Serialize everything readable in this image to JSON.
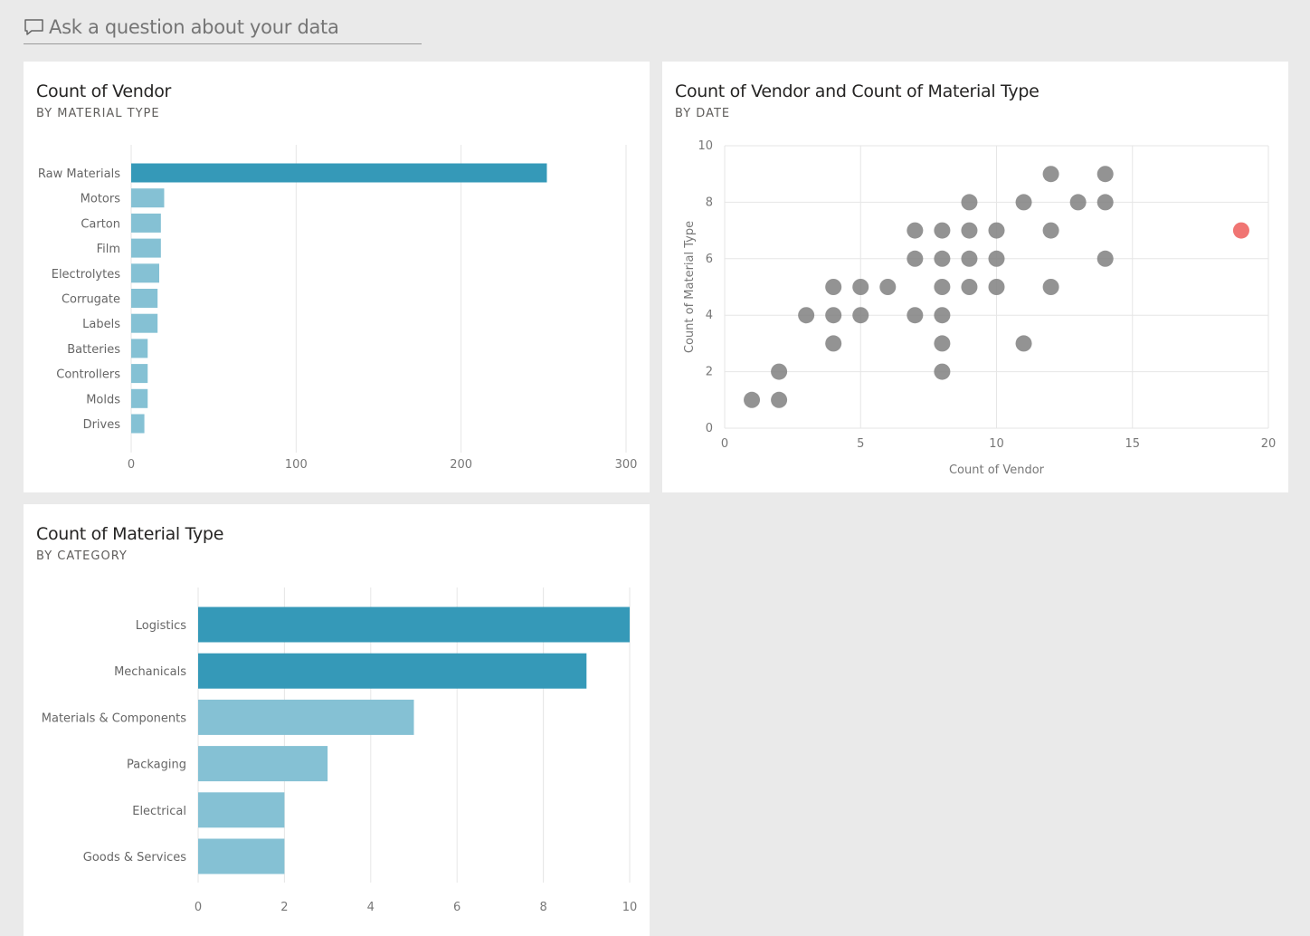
{
  "qa": {
    "placeholder": "Ask a question about your data",
    "icon": "chat-bubble-icon"
  },
  "colors": {
    "bar_dark": "#3599b8",
    "bar_light": "#85c1d4",
    "dot": "#808080",
    "dot_highlight": "#f07573",
    "grid": "#e6e6e6"
  },
  "tiles": [
    {
      "title": "Count of Vendor",
      "subtitle": "BY MATERIAL TYPE",
      "chart_data": {
        "type": "bar",
        "orientation": "horizontal",
        "title": "Count of Vendor",
        "subtitle": "BY MATERIAL TYPE",
        "categories": [
          "Raw Materials",
          "Motors",
          "Carton",
          "Film",
          "Electrolytes",
          "Corrugate",
          "Labels",
          "Batteries",
          "Controllers",
          "Molds",
          "Drives"
        ],
        "values": [
          252,
          20,
          18,
          18,
          17,
          16,
          16,
          10,
          10,
          10,
          8
        ],
        "highlight": [
          true,
          false,
          false,
          false,
          false,
          false,
          false,
          false,
          false,
          false,
          false
        ],
        "xlim": [
          0,
          300
        ],
        "xticks": [
          0,
          100,
          200,
          300
        ],
        "xtick_labels": [
          "0",
          "100",
          "200",
          "300"
        ],
        "grid": true
      }
    },
    {
      "title": "Count of Vendor and Count of Material Type",
      "subtitle": "BY DATE",
      "chart_data": {
        "type": "scatter",
        "title": "Count of Vendor and Count of Material Type",
        "subtitle": "BY DATE",
        "xlabel": "Count of Vendor",
        "ylabel": "Count of Material Type",
        "xlim": [
          0,
          20
        ],
        "ylim": [
          0,
          10
        ],
        "xticks": [
          0,
          5,
          10,
          15,
          20
        ],
        "xtick_labels": [
          "0",
          "5",
          "10",
          "15",
          "20"
        ],
        "yticks": [
          0,
          2,
          4,
          6,
          8,
          10
        ],
        "ytick_labels": [
          "0",
          "2",
          "4",
          "6",
          "8",
          "10"
        ],
        "grid": true,
        "points": [
          {
            "x": 1,
            "y": 1
          },
          {
            "x": 2,
            "y": 1
          },
          {
            "x": 2,
            "y": 2
          },
          {
            "x": 3,
            "y": 4
          },
          {
            "x": 4,
            "y": 4
          },
          {
            "x": 4,
            "y": 3
          },
          {
            "x": 4,
            "y": 5
          },
          {
            "x": 5,
            "y": 4
          },
          {
            "x": 5,
            "y": 5
          },
          {
            "x": 6,
            "y": 5
          },
          {
            "x": 7,
            "y": 4
          },
          {
            "x": 7,
            "y": 6
          },
          {
            "x": 7,
            "y": 7
          },
          {
            "x": 8,
            "y": 2
          },
          {
            "x": 8,
            "y": 3
          },
          {
            "x": 8,
            "y": 4
          },
          {
            "x": 8,
            "y": 5
          },
          {
            "x": 8,
            "y": 6
          },
          {
            "x": 8,
            "y": 7
          },
          {
            "x": 9,
            "y": 5
          },
          {
            "x": 9,
            "y": 6
          },
          {
            "x": 9,
            "y": 7
          },
          {
            "x": 9,
            "y": 8
          },
          {
            "x": 10,
            "y": 5
          },
          {
            "x": 10,
            "y": 6
          },
          {
            "x": 10,
            "y": 7
          },
          {
            "x": 11,
            "y": 3
          },
          {
            "x": 11,
            "y": 8
          },
          {
            "x": 12,
            "y": 5
          },
          {
            "x": 12,
            "y": 7
          },
          {
            "x": 12,
            "y": 9
          },
          {
            "x": 13,
            "y": 8
          },
          {
            "x": 14,
            "y": 6
          },
          {
            "x": 14,
            "y": 8
          },
          {
            "x": 14,
            "y": 9
          },
          {
            "x": 19,
            "y": 7,
            "highlight": true
          }
        ]
      }
    },
    {
      "title": "Count of Material Type",
      "subtitle": "BY CATEGORY",
      "chart_data": {
        "type": "bar",
        "orientation": "horizontal",
        "title": "Count of Material Type",
        "subtitle": "BY CATEGORY",
        "categories": [
          "Logistics",
          "Mechanicals",
          "Materials & Components",
          "Packaging",
          "Electrical",
          "Goods & Services"
        ],
        "values": [
          10,
          9,
          5,
          3,
          2,
          2
        ],
        "highlight": [
          true,
          true,
          false,
          false,
          false,
          false
        ],
        "xlim": [
          0,
          10
        ],
        "xticks": [
          0,
          2,
          4,
          6,
          8,
          10
        ],
        "xtick_labels": [
          "0",
          "2",
          "4",
          "6",
          "8",
          "10"
        ],
        "grid": true
      }
    }
  ]
}
